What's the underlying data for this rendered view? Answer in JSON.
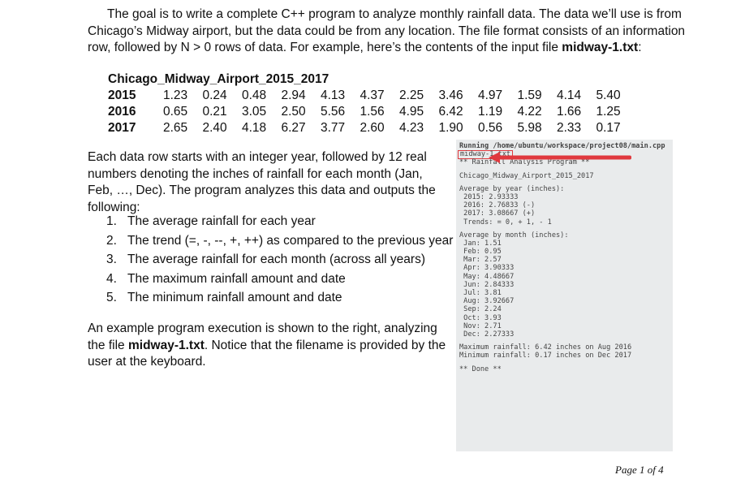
{
  "intro": {
    "part1": "The goal is to write a complete C++ program to analyze monthly rainfall data.  The data we’ll use is from Chicago’s Midway airport, but the data could be from any location.  The file format consists of an information row, followed by N > 0 rows of data.  For example, here’s the contents of the input file ",
    "filename": "midway-1.txt",
    "part2": ":"
  },
  "data_file": {
    "title": "Chicago_Midway_Airport_2015_2017",
    "rows": [
      {
        "year": "2015",
        "values": [
          "1.23",
          "0.24",
          "0.48",
          "2.94",
          "4.13",
          "4.37",
          "2.25",
          "3.46",
          "4.97",
          "1.59",
          "4.14",
          "5.40"
        ]
      },
      {
        "year": "2016",
        "values": [
          "0.65",
          "0.21",
          "3.05",
          "2.50",
          "5.56",
          "1.56",
          "4.95",
          "6.42",
          "1.19",
          "4.22",
          "1.66",
          "1.25"
        ]
      },
      {
        "year": "2017",
        "values": [
          "2.65",
          "2.40",
          "4.18",
          "6.27",
          "3.77",
          "2.60",
          "4.23",
          "1.90",
          "0.56",
          "5.98",
          "2.33",
          "0.17"
        ]
      }
    ]
  },
  "para2": "Each data row starts with an integer year, followed by 12 real numbers denoting the inches of rainfall for each month (Jan, Feb, …, Dec).  The program analyzes this data and outputs the following:",
  "tasks": [
    {
      "num": "1.",
      "text": "The average rainfall for each year"
    },
    {
      "num": "2.",
      "text": "The trend (=, -, --, +, ++) as compared to the previous year"
    },
    {
      "num": "3.",
      "text": "The average rainfall for each month (across all years)"
    },
    {
      "num": "4.",
      "text": "The maximum rainfall amount and date"
    },
    {
      "num": "5.",
      "text": "The minimum rainfall amount and date"
    }
  ],
  "para3": {
    "part1": "An example program execution is shown to the right, analyzing the file ",
    "filename": "midway-1.txt",
    "part2": ".  Notice that the filename is provided by the user at the keyboard."
  },
  "console": {
    "running": "Running /home/ubuntu/workspace/project08/main.cpp",
    "input": "midway-1.txt",
    "banner": "** Rainfall Analysis Program **",
    "header": "Chicago_Midway_Airport_2015_2017",
    "avg_year_title": "Average by year (inches):",
    "avg_year": [
      " 2015: 2.93333",
      " 2016: 2.76833 (-)",
      " 2017: 3.08667 (+)",
      " Trends: = 0, + 1, - 1"
    ],
    "avg_month_title": "Average by month (inches):",
    "avg_month": [
      " Jan: 1.51",
      " Feb: 0.95",
      " Mar: 2.57",
      " Apr: 3.90333",
      " May: 4.48667",
      " Jun: 2.84333",
      " Jul: 3.81",
      " Aug: 3.92667",
      " Sep: 2.24",
      " Oct: 3.93",
      " Nov: 2.71",
      " Dec: 2.27333"
    ],
    "max": "Maximum rainfall: 6.42 inches on Aug 2016",
    "min": "Minimum rainfall: 0.17 inches on Dec 2017",
    "done": "** Done **",
    "arrow_color": "#e0393e"
  },
  "footer": {
    "page": "Page 1 of 4"
  }
}
